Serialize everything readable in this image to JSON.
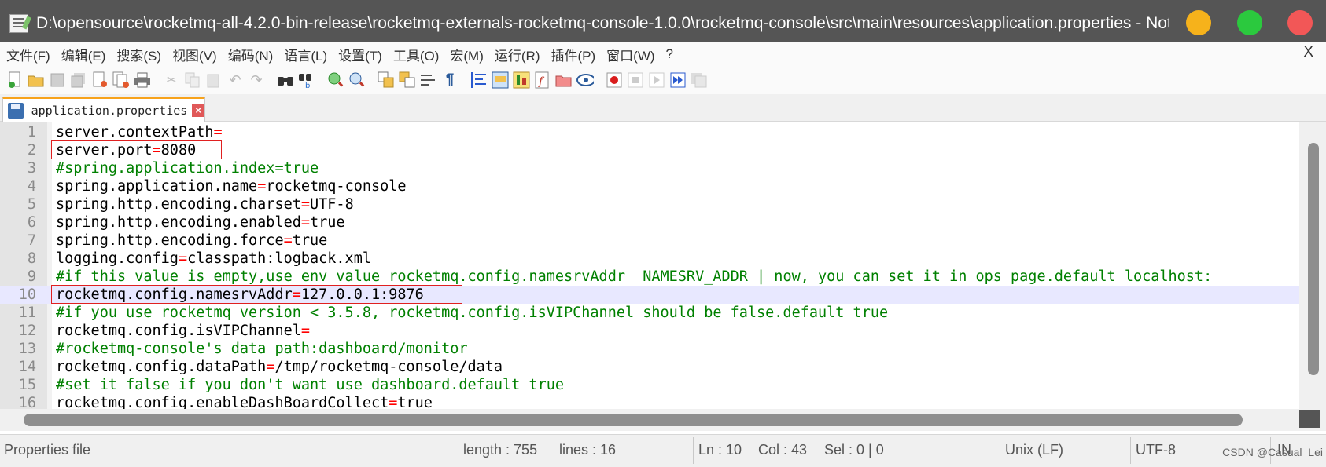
{
  "window": {
    "title": "D:\\opensource\\rocketmq-all-4.2.0-bin-release\\rocketmq-externals-rocketmq-console-1.0.0\\rocketmq-console\\src\\main\\resources\\application.properties - Notepad..."
  },
  "menu": {
    "items": [
      "文件(F)",
      "编辑(E)",
      "搜索(S)",
      "视图(V)",
      "编码(N)",
      "语言(L)",
      "设置(T)",
      "工具(O)",
      "宏(M)",
      "运行(R)",
      "插件(P)",
      "窗口(W)",
      "?"
    ],
    "close_label": "X"
  },
  "tab": {
    "label": "application.properties"
  },
  "editor": {
    "lines": [
      {
        "num": "1",
        "key": "server.contextPath",
        "op": "=",
        "val": ""
      },
      {
        "num": "2",
        "key": "server.port",
        "op": "=",
        "val": "8080"
      },
      {
        "num": "3",
        "comment": "#spring.application.index=true"
      },
      {
        "num": "4",
        "key": "spring.application.name",
        "op": "=",
        "val": "rocketmq-console"
      },
      {
        "num": "5",
        "key": "spring.http.encoding.charset",
        "op": "=",
        "val": "UTF-8"
      },
      {
        "num": "6",
        "key": "spring.http.encoding.enabled",
        "op": "=",
        "val": "true"
      },
      {
        "num": "7",
        "key": "spring.http.encoding.force",
        "op": "=",
        "val": "true"
      },
      {
        "num": "8",
        "key": "logging.config",
        "op": "=",
        "val": "classpath:logback.xml"
      },
      {
        "num": "9",
        "comment": "#if this value is empty,use env value rocketmq.config.namesrvAddr  NAMESRV_ADDR | now, you can set it in ops page.default localhost:"
      },
      {
        "num": "10",
        "key": "rocketmq.config.namesrvAddr",
        "op": "=",
        "val": "127.0.0.1:9876"
      },
      {
        "num": "11",
        "comment": "#if you use rocketmq version < 3.5.8, rocketmq.config.isVIPChannel should be false.default true"
      },
      {
        "num": "12",
        "key": "rocketmq.config.isVIPChannel",
        "op": "=",
        "val": ""
      },
      {
        "num": "13",
        "comment": "#rocketmq-console's data path:dashboard/monitor"
      },
      {
        "num": "14",
        "key": "rocketmq.config.dataPath",
        "op": "=",
        "val": "/tmp/rocketmq-console/data"
      },
      {
        "num": "15",
        "comment": "#set it false if you don't want use dashboard.default true"
      },
      {
        "num": "16",
        "key": "rocketmq.config.enableDashBoardCollect",
        "op": "=",
        "val": "true"
      }
    ]
  },
  "status": {
    "file_type": "Properties file",
    "length": "length : 755",
    "lines": "lines : 16",
    "ln": "Ln : 10",
    "col": "Col : 43",
    "sel": "Sel : 0 | 0",
    "eol": "Unix (LF)",
    "encoding": "UTF-8",
    "ins": "IN",
    "watermark": "CSDN @Casual_Lei"
  },
  "toolbar_icons": [
    "new-file-icon",
    "open-file-icon",
    "save-icon",
    "save-all-icon",
    "close-icon",
    "close-all-icon",
    "print-icon",
    "cut-icon",
    "copy-icon",
    "paste-icon",
    "undo-icon",
    "redo-icon",
    "find-icon",
    "replace-icon",
    "zoom-in-icon",
    "zoom-out-icon",
    "sync-vertical-icon",
    "sync-horizontal-icon",
    "word-wrap-icon",
    "show-all-chars-icon",
    "indent-guide-icon",
    "user-language-icon",
    "document-map-icon",
    "function-list-icon",
    "folder-workspace-icon",
    "monitoring-icon",
    "record-macro-icon",
    "stop-record-icon",
    "playback-icon",
    "run-macro-multiple-icon",
    "save-macro-icon"
  ]
}
